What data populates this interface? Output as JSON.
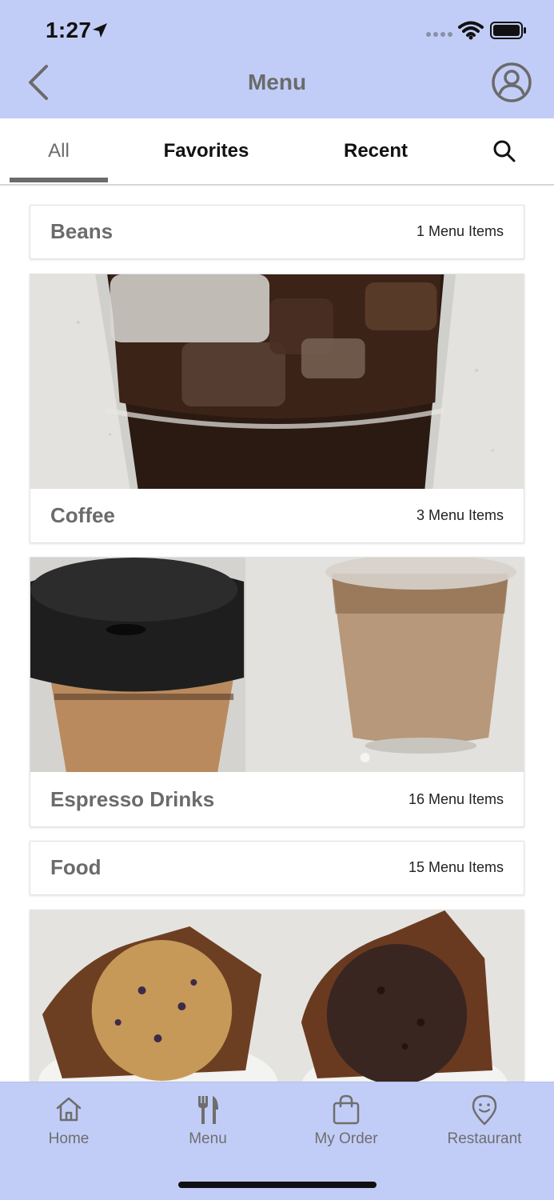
{
  "status_bar": {
    "time": "1:27"
  },
  "header": {
    "title": "Menu"
  },
  "tabs": [
    {
      "label": "All"
    },
    {
      "label": "Favorites"
    },
    {
      "label": "Recent"
    }
  ],
  "categories": [
    {
      "name": "Beans",
      "count": "1 Menu Items"
    },
    {
      "name": "Coffee",
      "count": "3 Menu Items"
    },
    {
      "name": "Espresso Drinks",
      "count": "16 Menu Items"
    },
    {
      "name": "Food",
      "count": "15 Menu Items"
    }
  ],
  "bottom_nav": [
    {
      "label": "Home",
      "icon": "home-icon"
    },
    {
      "label": "Menu",
      "icon": "fork-knife-icon"
    },
    {
      "label": "My Order",
      "icon": "shopping-bag-icon"
    },
    {
      "label": "Restaurant",
      "icon": "location-pin-icon"
    }
  ],
  "colors": {
    "header_bg": "#c2cdf7",
    "accent": "#6b6b6b"
  }
}
